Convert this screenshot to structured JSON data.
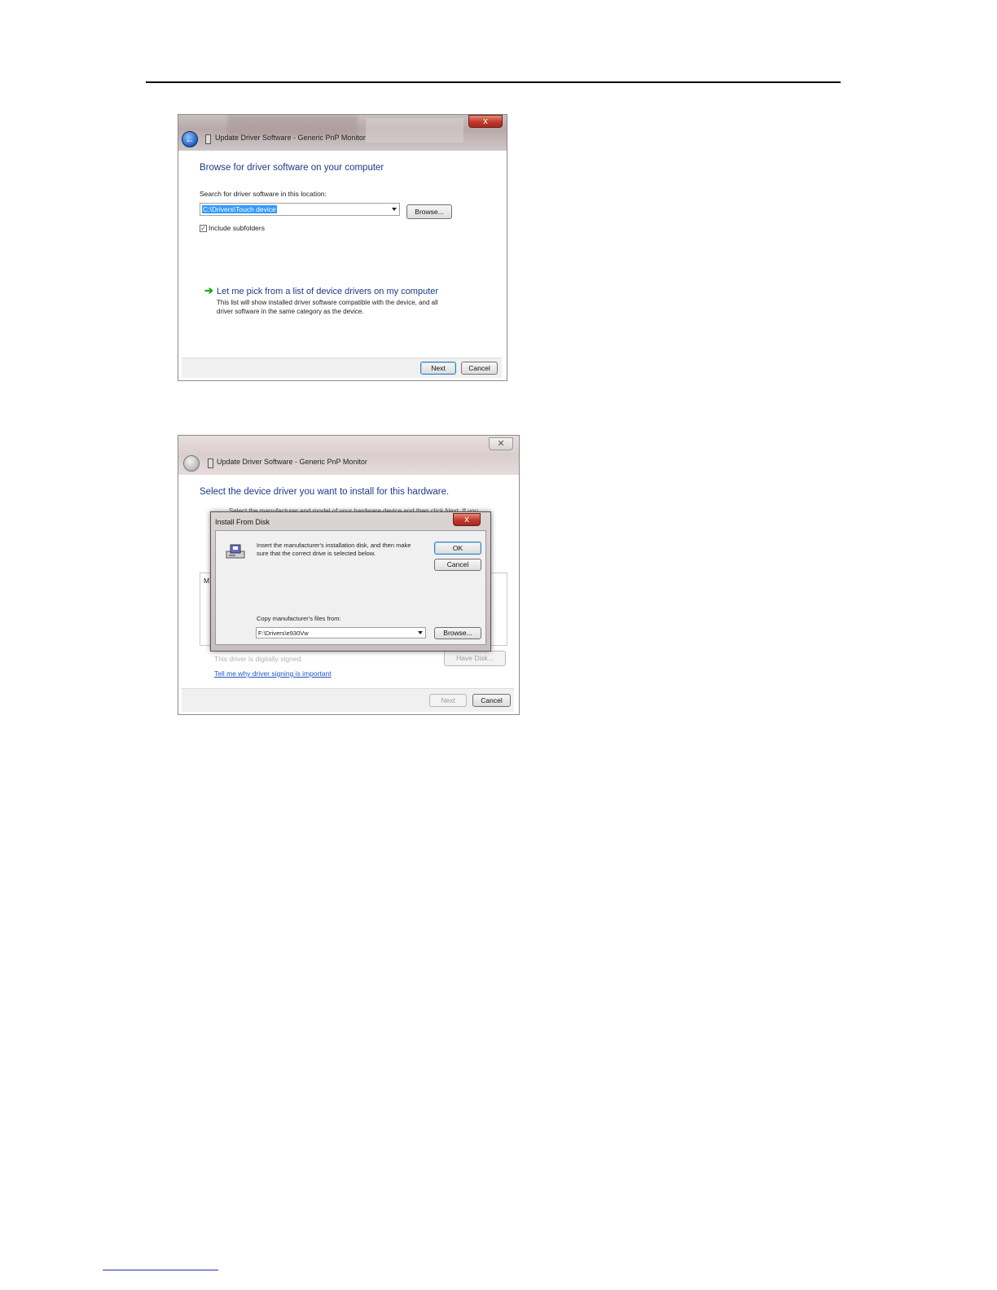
{
  "window1": {
    "title": "Update Driver Software - Generic PnP Monitor",
    "close_glyph": "x",
    "back_glyph": "←",
    "heading": "Browse for driver software on your computer",
    "search_label": "Search for driver software in this location:",
    "search_value": "C:\\Drivers\\Touch device",
    "browse_label": "Browse...",
    "include_subfolders_label": "Include subfolders",
    "include_subfolders_checked": true,
    "check_glyph": "✓",
    "pick_arrow_glyph": "➔",
    "pick_title": "Let me pick from a list of device drivers on my computer",
    "pick_desc_line1": "This list will show installed driver software compatible with the device, and all",
    "pick_desc_line2": "driver software in the same category as the device.",
    "next_label": "Next",
    "cancel_label": "Cancel"
  },
  "window2": {
    "title": "Update Driver Software - Generic PnP Monitor",
    "close_glyph": "✕",
    "heading": "Select the device driver you want to install for this hardware.",
    "behind_text": "Select the manufacturer and model of your hardware device and then click Next. If you",
    "list_letter": "M",
    "signed_text": "This driver is digitally signed.",
    "have_disk_label": "Have Disk...",
    "signing_link": "Tell me why driver signing is important",
    "next_label": "Next",
    "cancel_label": "Cancel"
  },
  "dialog": {
    "title": "Install From Disk",
    "close_glyph": "x",
    "message_line1": "Insert the manufacturer's installation disk, and then make",
    "message_line2": "sure that the correct drive is selected below.",
    "ok_label": "OK",
    "cancel_label": "Cancel",
    "copy_label": "Copy manufacturer's files from:",
    "copy_value": "F:\\Drivers\\e930Vw",
    "browse_label": "Browse..."
  }
}
